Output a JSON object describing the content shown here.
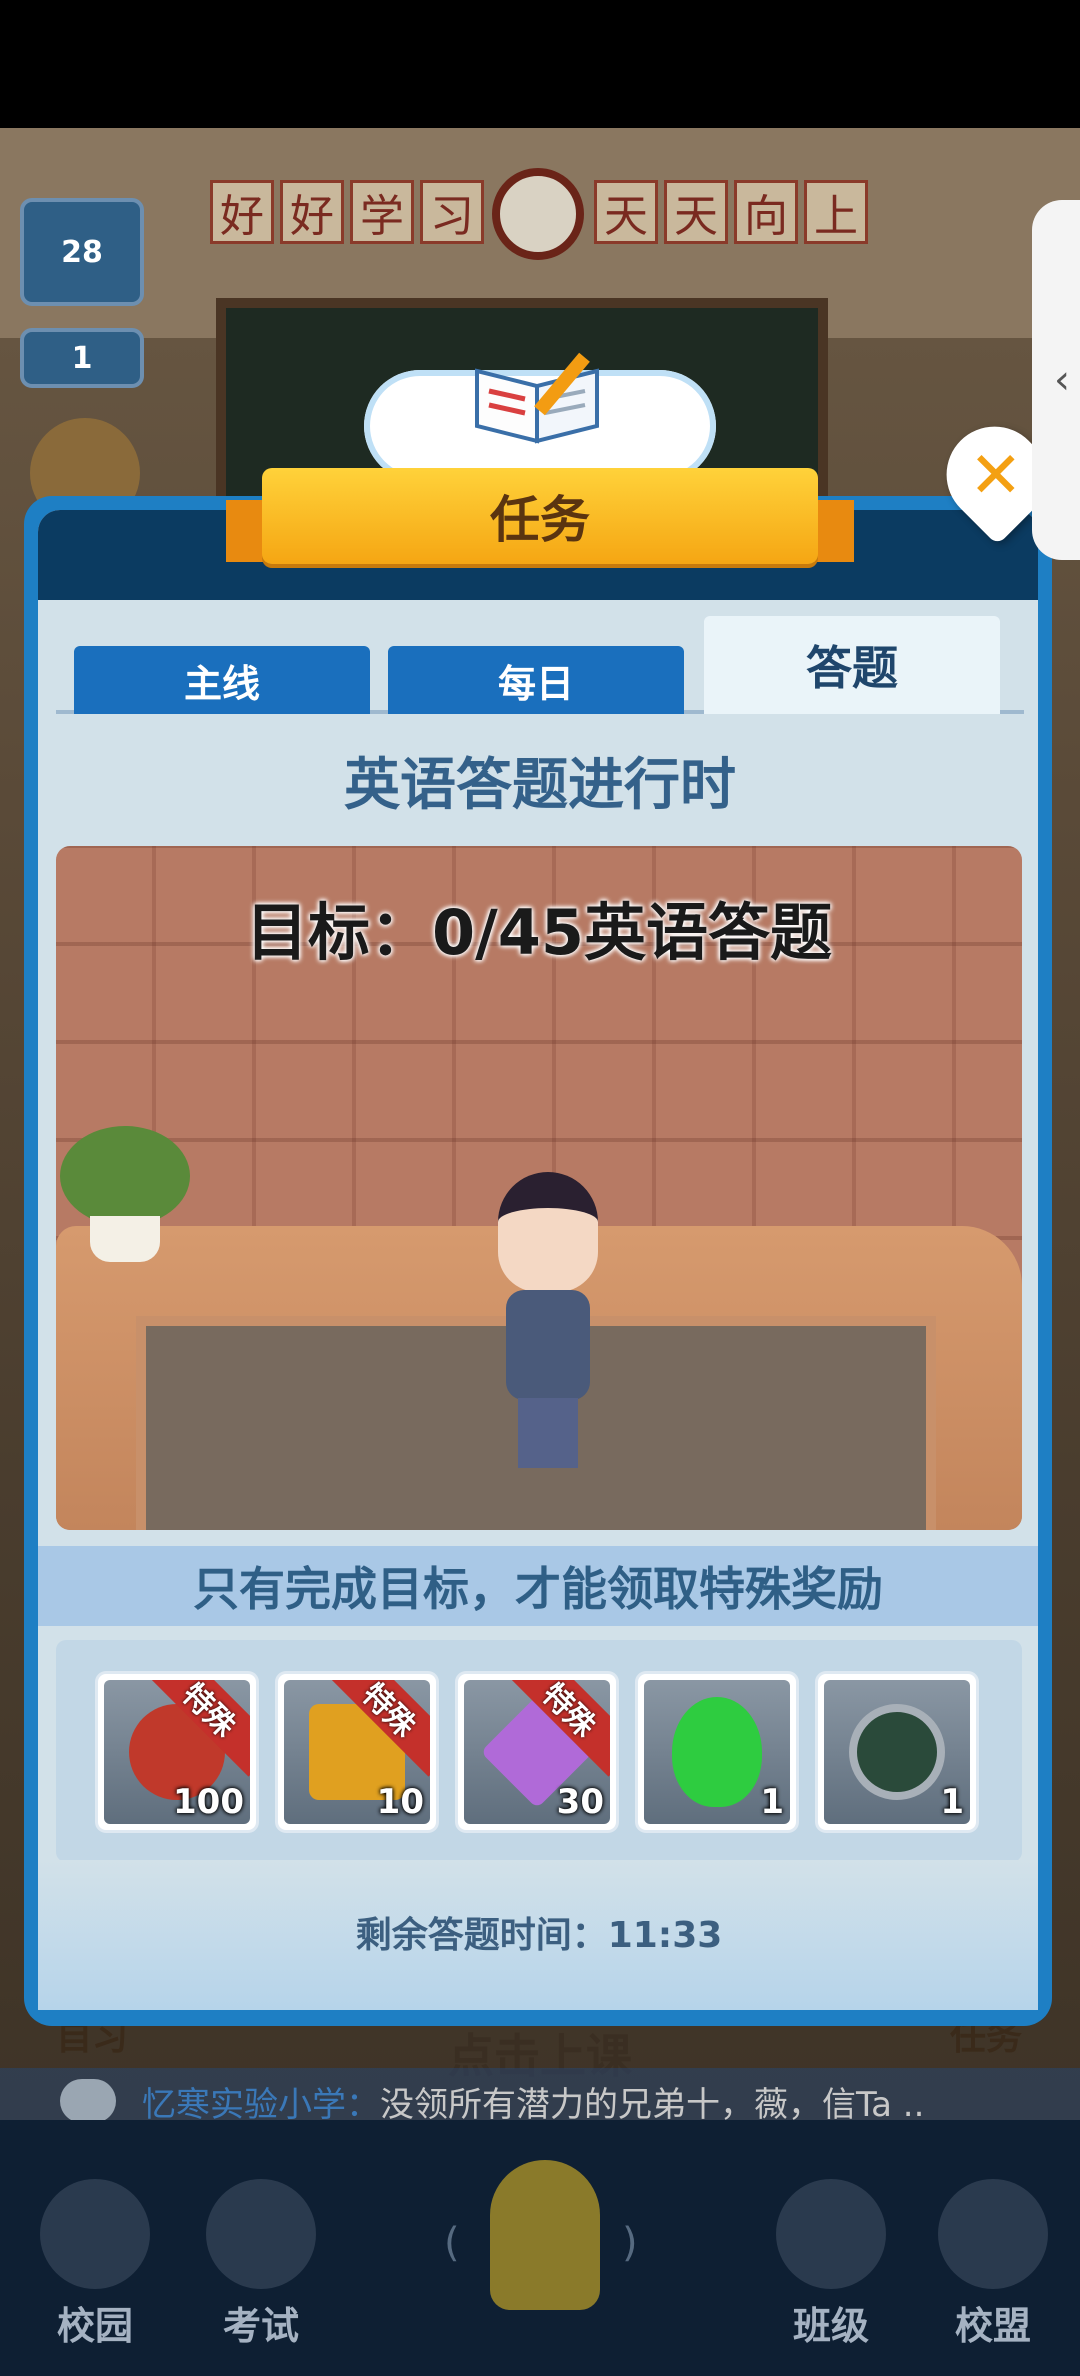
{
  "background": {
    "banner_left": [
      "好",
      "好",
      "学",
      "习"
    ],
    "banner_right": [
      "天",
      "天",
      "向",
      "上"
    ],
    "level_badge": "28",
    "rank_badge": "1",
    "hint": "点击上课",
    "left_label": "自习",
    "right_label": "任务"
  },
  "dialog": {
    "title": "任务",
    "close_icon": "close-x-icon",
    "tabs": [
      {
        "label": "主线"
      },
      {
        "label": "每日"
      },
      {
        "label": "答题"
      }
    ],
    "active_tab": "答题",
    "subtitle": "英语答题进行时",
    "goal": "目标：0/45英语答题",
    "info": "只有完成目标，才能领取特殊奖励",
    "rewards": [
      {
        "name": "teacher-medal",
        "tag": "特殊",
        "count": "100",
        "color": "#c0392b"
      },
      {
        "name": "gold-scroll",
        "tag": "特殊",
        "count": "10",
        "color": "#e0a020"
      },
      {
        "name": "purple-diamond",
        "tag": "特殊",
        "count": "30",
        "color": "#b06ad8"
      },
      {
        "name": "green-balloon",
        "tag": "",
        "count": "1",
        "color": "#2ecc40"
      },
      {
        "name": "heart-compass",
        "tag": "",
        "count": "1",
        "color": "#7a2a2a"
      }
    ],
    "timer": "剩余答题时间：11:33"
  },
  "ticker": {
    "school": "忆寒实验小学：",
    "message": "没领所有潜力的兄弟十，薇，信Ta .."
  },
  "nav": {
    "items": [
      {
        "label": "校园"
      },
      {
        "label": "考试"
      },
      {
        "label": "班级"
      },
      {
        "label": "校盟"
      }
    ],
    "paren_left": "(",
    "paren_right": ")"
  },
  "edge_handle": "‹"
}
